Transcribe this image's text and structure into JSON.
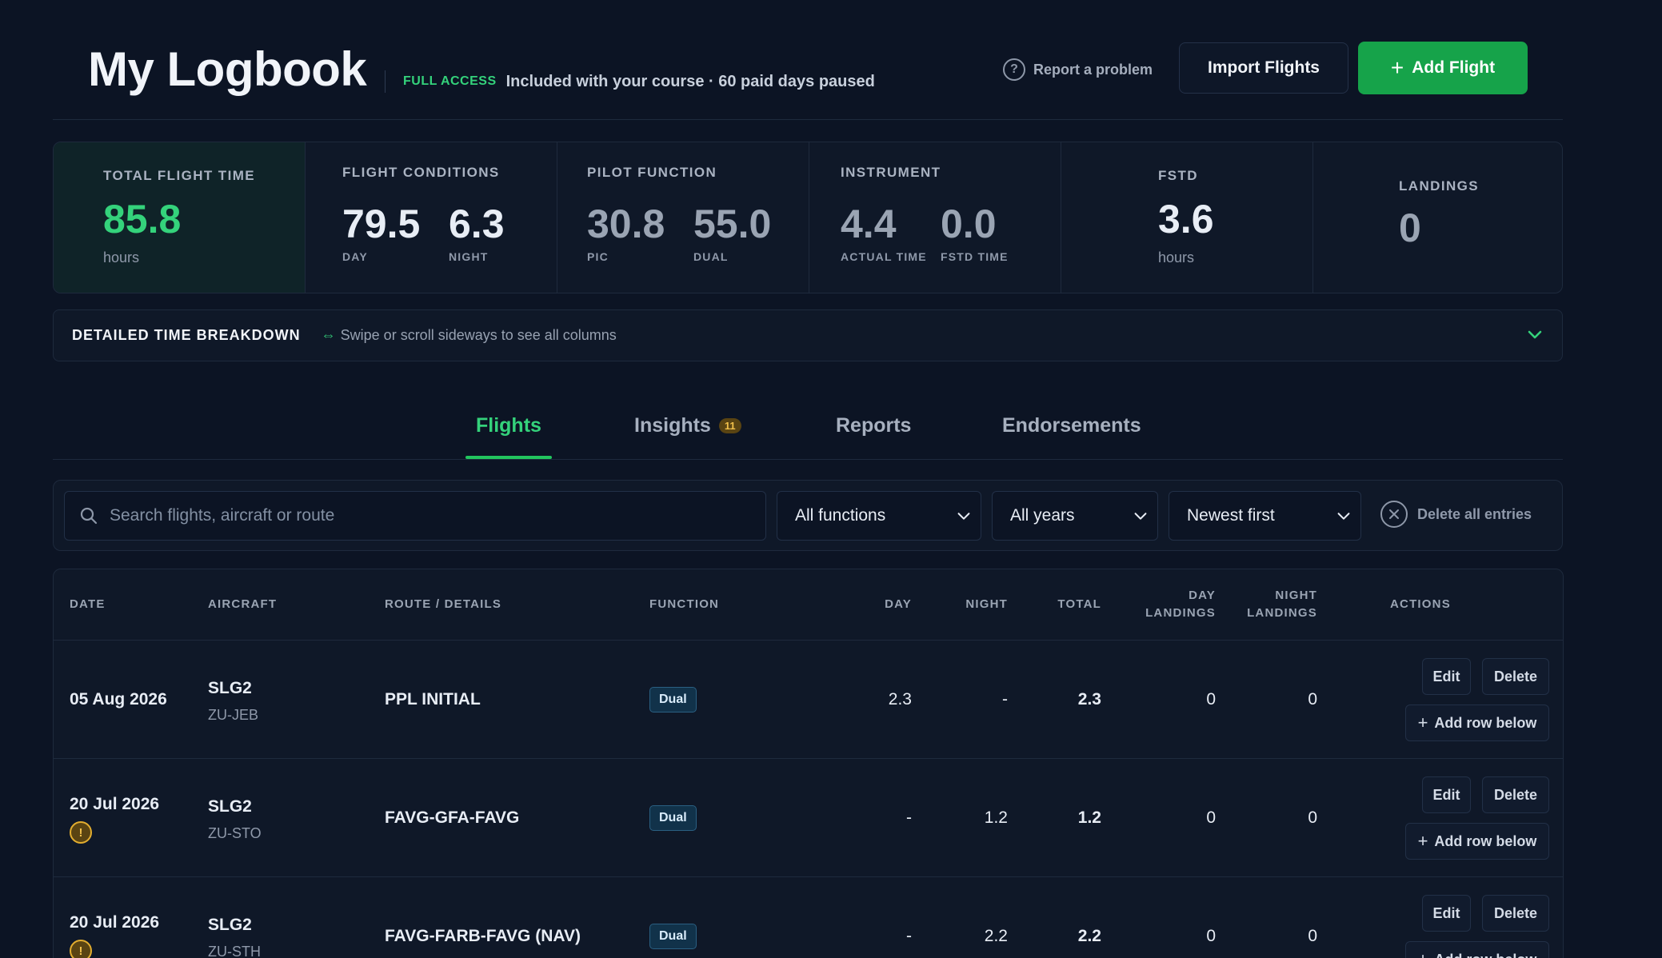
{
  "header": {
    "title": "My Logbook",
    "access_badge": "FULL ACCESS",
    "access_text": "Included with your course · 60 paid days paused",
    "report_label": "Report a problem",
    "import_label": "Import Flights",
    "add_label": "Add Flight"
  },
  "stats": {
    "total": {
      "label": "TOTAL FLIGHT TIME",
      "value": "85.8",
      "unit": "hours"
    },
    "conditions": {
      "label": "FLIGHT CONDITIONS",
      "day": "79.5",
      "day_label": "DAY",
      "night": "6.3",
      "night_label": "NIGHT"
    },
    "function": {
      "label": "PILOT FUNCTION",
      "pic": "30.8",
      "pic_label": "PIC",
      "dual": "55.0",
      "dual_label": "DUAL"
    },
    "instrument": {
      "label": "INSTRUMENT",
      "actual": "4.4",
      "actual_label": "ACTUAL TIME",
      "fstd": "0.0",
      "fstd_label": "FSTD TIME"
    },
    "fstd": {
      "label": "FSTD",
      "value": "3.6",
      "unit": "hours"
    },
    "landings": {
      "label": "LANDINGS",
      "value": "0"
    }
  },
  "breakdown": {
    "title": "DETAILED TIME BREAKDOWN",
    "hint": "Swipe or scroll sideways to see all columns"
  },
  "tabs": {
    "flights": "Flights",
    "insights": "Insights",
    "insights_count": "11",
    "reports": "Reports",
    "endorsements": "Endorsements"
  },
  "filters": {
    "search_placeholder": "Search flights, aircraft or route",
    "function": "All functions",
    "years": "All years",
    "sort": "Newest first",
    "delete_all": "Delete all entries"
  },
  "table": {
    "headers": {
      "date": "DATE",
      "aircraft": "AIRCRAFT",
      "route": "ROUTE / DETAILS",
      "function": "FUNCTION",
      "day": "DAY",
      "night": "NIGHT",
      "total": "TOTAL",
      "day_landings_1": "DAY",
      "day_landings_2": "LANDINGS",
      "night_landings_1": "NIGHT",
      "night_landings_2": "LANDINGS",
      "actions": "ACTIONS"
    },
    "actions": {
      "edit": "Edit",
      "delete": "Delete",
      "add_row": "Add row below"
    },
    "rows": [
      {
        "date": "05 Aug 2026",
        "aircraft": "SLG2",
        "reg": "ZU-JEB",
        "route": "PPL INITIAL",
        "function": "Dual",
        "day": "2.3",
        "night": "-",
        "total": "2.3",
        "day_landings": "0",
        "night_landings": "0"
      },
      {
        "date": "20 Jul 2026",
        "warn": "!",
        "aircraft": "SLG2",
        "reg": "ZU-STO",
        "route": "FAVG-GFA-FAVG",
        "function": "Dual",
        "day": "-",
        "night": "1.2",
        "total": "1.2",
        "day_landings": "0",
        "night_landings": "0"
      },
      {
        "date": "20 Jul 2026",
        "warn": "!",
        "aircraft": "SLG2",
        "reg": "ZU-STH",
        "route": "FAVG-FARB-FAVG (NAV)",
        "function": "Dual",
        "day": "-",
        "night": "2.2",
        "total": "2.2",
        "day_landings": "0",
        "night_landings": "0"
      }
    ]
  }
}
